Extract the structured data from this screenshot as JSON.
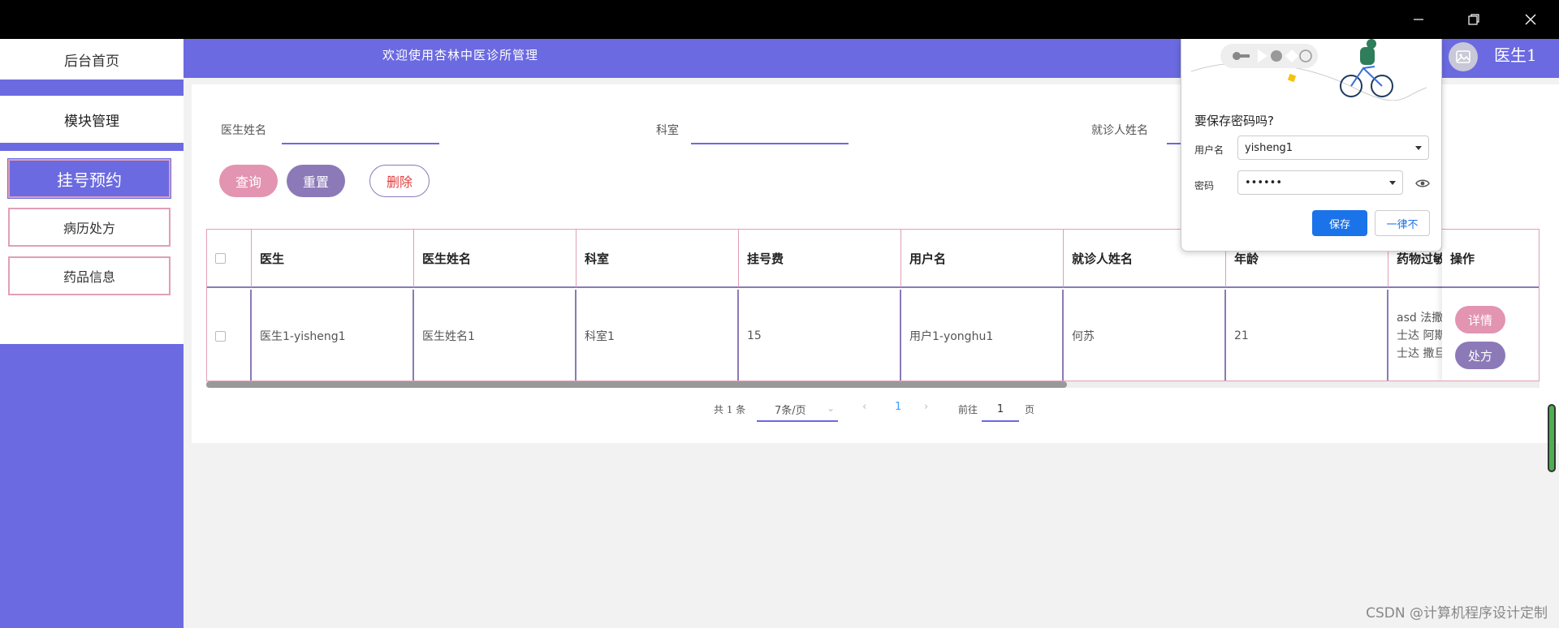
{
  "sidebar": {
    "home": "后台首页",
    "module": "模块管理",
    "items": [
      {
        "label": "挂号预约"
      },
      {
        "label": "病历处方"
      },
      {
        "label": "药品信息"
      }
    ]
  },
  "header": {
    "welcome": "欢迎使用杏林中医诊所管理",
    "user": "医生1"
  },
  "search": {
    "doctor_name_label": "医生姓名",
    "department_label": "科室",
    "patient_name_label": "就诊人姓名"
  },
  "actions": {
    "query": "查询",
    "reset": "重置",
    "delete": "删除"
  },
  "table": {
    "columns": [
      "医生",
      "医生姓名",
      "科室",
      "挂号费",
      "用户名",
      "就诊人姓名",
      "年龄",
      "药物过敏",
      "操作"
    ],
    "rows": [
      {
        "doctor": "医生1-yisheng1",
        "doctor_name": "医生姓名1",
        "department": "科室1",
        "fee": "15",
        "username": "用户1-yonghu1",
        "patient_name": "何苏",
        "age": "21",
        "allergy_lines": [
          "asd 法撒",
          "士达 阿斯",
          "士达 撒旦"
        ],
        "detail": "详情",
        "prescription": "处方"
      }
    ]
  },
  "pagination": {
    "total": "共 1 条",
    "page_size": "7条/页",
    "current": "1",
    "goto": "前往",
    "goto_value": "1",
    "page_unit": "页"
  },
  "password_popup": {
    "title": "要保存密码吗?",
    "username_label": "用户名",
    "username_value": "yisheng1",
    "password_label": "密码",
    "password_value": "••••••",
    "save": "保存",
    "never": "一律不"
  },
  "watermark": "CSDN @计算机程序设计定制",
  "colors": {
    "primary": "#6b6ae0",
    "pink": "#e394b0",
    "purple": "#8c79b8",
    "chrome_blue": "#1a73e8"
  }
}
